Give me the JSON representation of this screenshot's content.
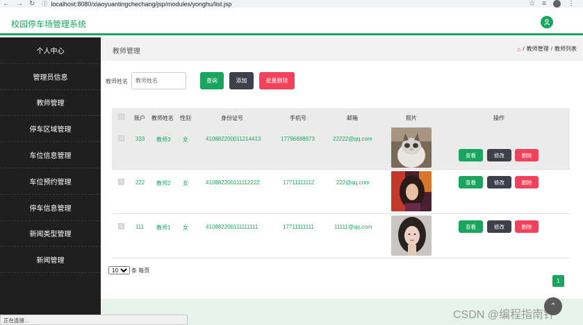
{
  "browser": {
    "url": "localhost:8080/xiaoyuantingchechang/jsp/modules/yonghu/list.jsp"
  },
  "header": {
    "brand": "校园停车场管理系统"
  },
  "sidebar": {
    "items": [
      {
        "label": "个人中心"
      },
      {
        "label": "管理员信息"
      },
      {
        "label": "教师管理"
      },
      {
        "label": "停车区域管理"
      },
      {
        "label": "车位信息管理"
      },
      {
        "label": "车位预约管理"
      },
      {
        "label": "停车信息管理"
      },
      {
        "label": "新闻类型管理"
      },
      {
        "label": "新闻管理"
      }
    ]
  },
  "titlebar": {
    "title": "教师管理",
    "crumb_1": "教师管理",
    "crumb_2": "教师列表",
    "separator": "/"
  },
  "search": {
    "label": "教师姓名",
    "placeholder": "教师姓名",
    "query_btn": "查询",
    "add_btn": "添加",
    "batch_delete_btn": "批量删除"
  },
  "table": {
    "headers": {
      "account": "账户",
      "name": "教师姓名",
      "gender": "性别",
      "idcard": "身份证号",
      "phone": "手机号",
      "email": "邮箱",
      "photo": "照片",
      "actions": "操作"
    },
    "rows": [
      {
        "account": "333",
        "name": "教师3",
        "gender": "女",
        "idcard": "410882200011214413",
        "phone": "17796688973",
        "email": "22222@qq.com"
      },
      {
        "account": "222",
        "name": "教师2",
        "gender": "女",
        "idcard": "410882200111112222",
        "phone": "17711111112",
        "email": "222@qq.com"
      },
      {
        "account": "111",
        "name": "教师1",
        "gender": "女",
        "idcard": "410882200111111111",
        "phone": "17711111111",
        "email": "11111@qq.com"
      }
    ],
    "row_actions": {
      "view": "查看",
      "edit": "修改",
      "delete": "删除"
    }
  },
  "pagination": {
    "page_size": "10",
    "per_page_text": "条 每页",
    "current_page": "1"
  },
  "status_bar": "正在连接...",
  "watermark": "CSDN @编程指南针",
  "colors": {
    "accent": "#1aa55e",
    "dark": "#3d3f4b",
    "danger": "#f2415a",
    "sidebar": "#1f1f1f"
  }
}
